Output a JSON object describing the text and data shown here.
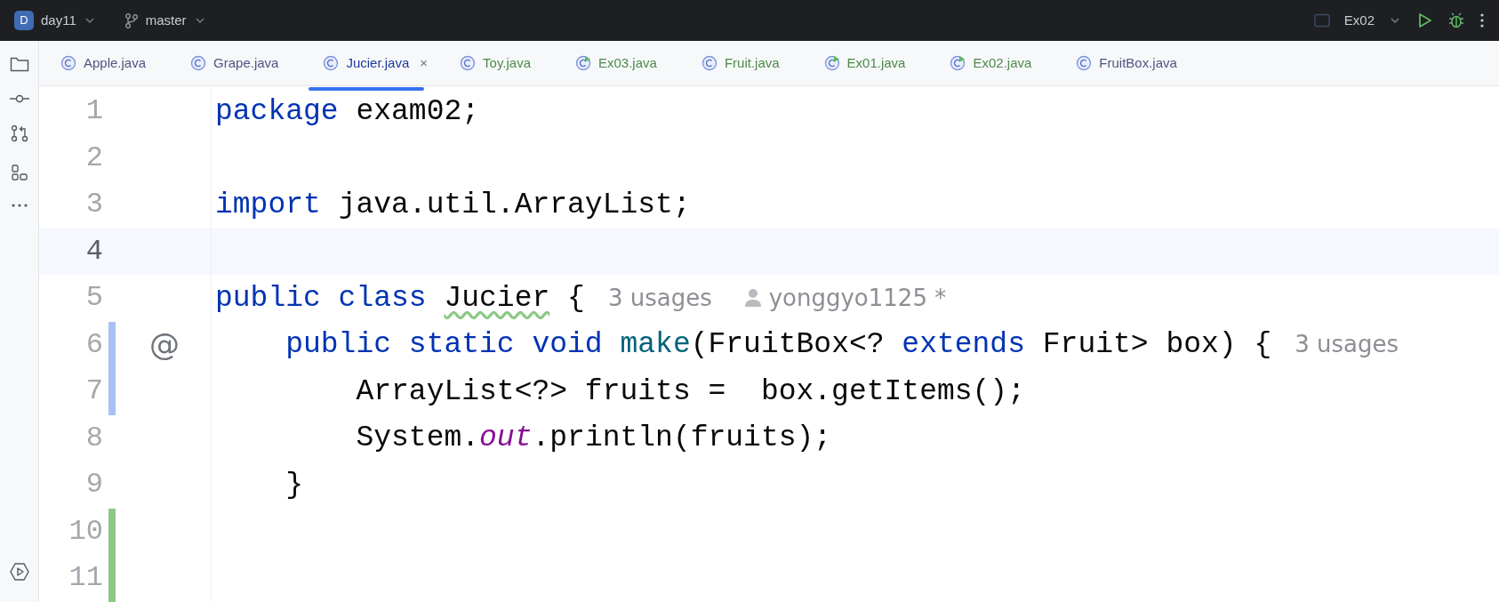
{
  "title_bar": {
    "project_initial": "D",
    "project": "day11",
    "branch": "master",
    "run_config": "Ex02"
  },
  "tabs": [
    {
      "label": "Apple.java",
      "kind": "class",
      "added": false,
      "selected": false
    },
    {
      "label": "Grape.java",
      "kind": "class",
      "added": false,
      "selected": false
    },
    {
      "label": "Jucier.java",
      "kind": "class",
      "added": false,
      "selected": true,
      "close": "×"
    },
    {
      "label": "Toy.java",
      "kind": "class",
      "added": true,
      "selected": false
    },
    {
      "label": "Ex03.java",
      "kind": "runnable",
      "added": true,
      "selected": false
    },
    {
      "label": "Fruit.java",
      "kind": "class",
      "added": true,
      "selected": false
    },
    {
      "label": "Ex01.java",
      "kind": "runnable",
      "added": true,
      "selected": false
    },
    {
      "label": "Ex02.java",
      "kind": "runnable",
      "added": true,
      "selected": false
    },
    {
      "label": "FruitBox.java",
      "kind": "class",
      "added": false,
      "selected": false
    }
  ],
  "editor": {
    "lines": [
      {
        "number": "1",
        "current": false,
        "modified": false,
        "added": false,
        "tokens": [
          {
            "text": "package ",
            "kind": "keyword"
          },
          {
            "text": "exam02;",
            "kind": "plain"
          }
        ]
      },
      {
        "number": "2",
        "current": false,
        "modified": false,
        "added": false
      },
      {
        "number": "3",
        "current": false,
        "modified": false,
        "added": false,
        "tokens": [
          {
            "text": "import ",
            "kind": "keyword"
          },
          {
            "text": "java.util.ArrayList;",
            "kind": "plain"
          }
        ]
      },
      {
        "number": "4",
        "current": true,
        "modified": false,
        "added": false
      },
      {
        "number": "5",
        "current": false,
        "modified": false,
        "added": false,
        "tokens": [
          {
            "text": "public class ",
            "kind": "keyword"
          },
          {
            "text": "Jucier",
            "kind": "typo"
          },
          {
            "text": " {",
            "kind": "plain"
          },
          {
            "text": "3 usages",
            "kind": "hint"
          },
          {
            "text": "yonggyo1125 *",
            "kind": "author"
          }
        ]
      },
      {
        "number": "6",
        "current": false,
        "modified": true,
        "added": false,
        "gutter_icon": "@",
        "tokens": [
          {
            "text": "    public static void ",
            "kind": "keyword"
          },
          {
            "text": "make",
            "kind": "method"
          },
          {
            "text": "(FruitBox<? ",
            "kind": "plain"
          },
          {
            "text": "extends",
            "kind": "keyword"
          },
          {
            "text": " Fruit> box) {",
            "kind": "plain"
          },
          {
            "text": "3 usages",
            "kind": "hint"
          }
        ]
      },
      {
        "number": "7",
        "current": false,
        "modified": true,
        "added": false,
        "tokens": [
          {
            "text": "        ArrayList<?> fruits =  box.getItems();",
            "kind": "plain"
          }
        ]
      },
      {
        "number": "8",
        "current": false,
        "modified": false,
        "added": false,
        "tokens": [
          {
            "text": "        System.",
            "kind": "plain"
          },
          {
            "text": "out",
            "kind": "static"
          },
          {
            "text": ".println(fruits);",
            "kind": "plain"
          }
        ]
      },
      {
        "number": "9",
        "current": false,
        "modified": false,
        "added": false,
        "tokens": [
          {
            "text": "    }",
            "kind": "plain"
          }
        ]
      },
      {
        "number": "10",
        "current": false,
        "modified": false,
        "added": true
      },
      {
        "number": "11",
        "current": false,
        "modified": false,
        "added": true
      }
    ]
  }
}
